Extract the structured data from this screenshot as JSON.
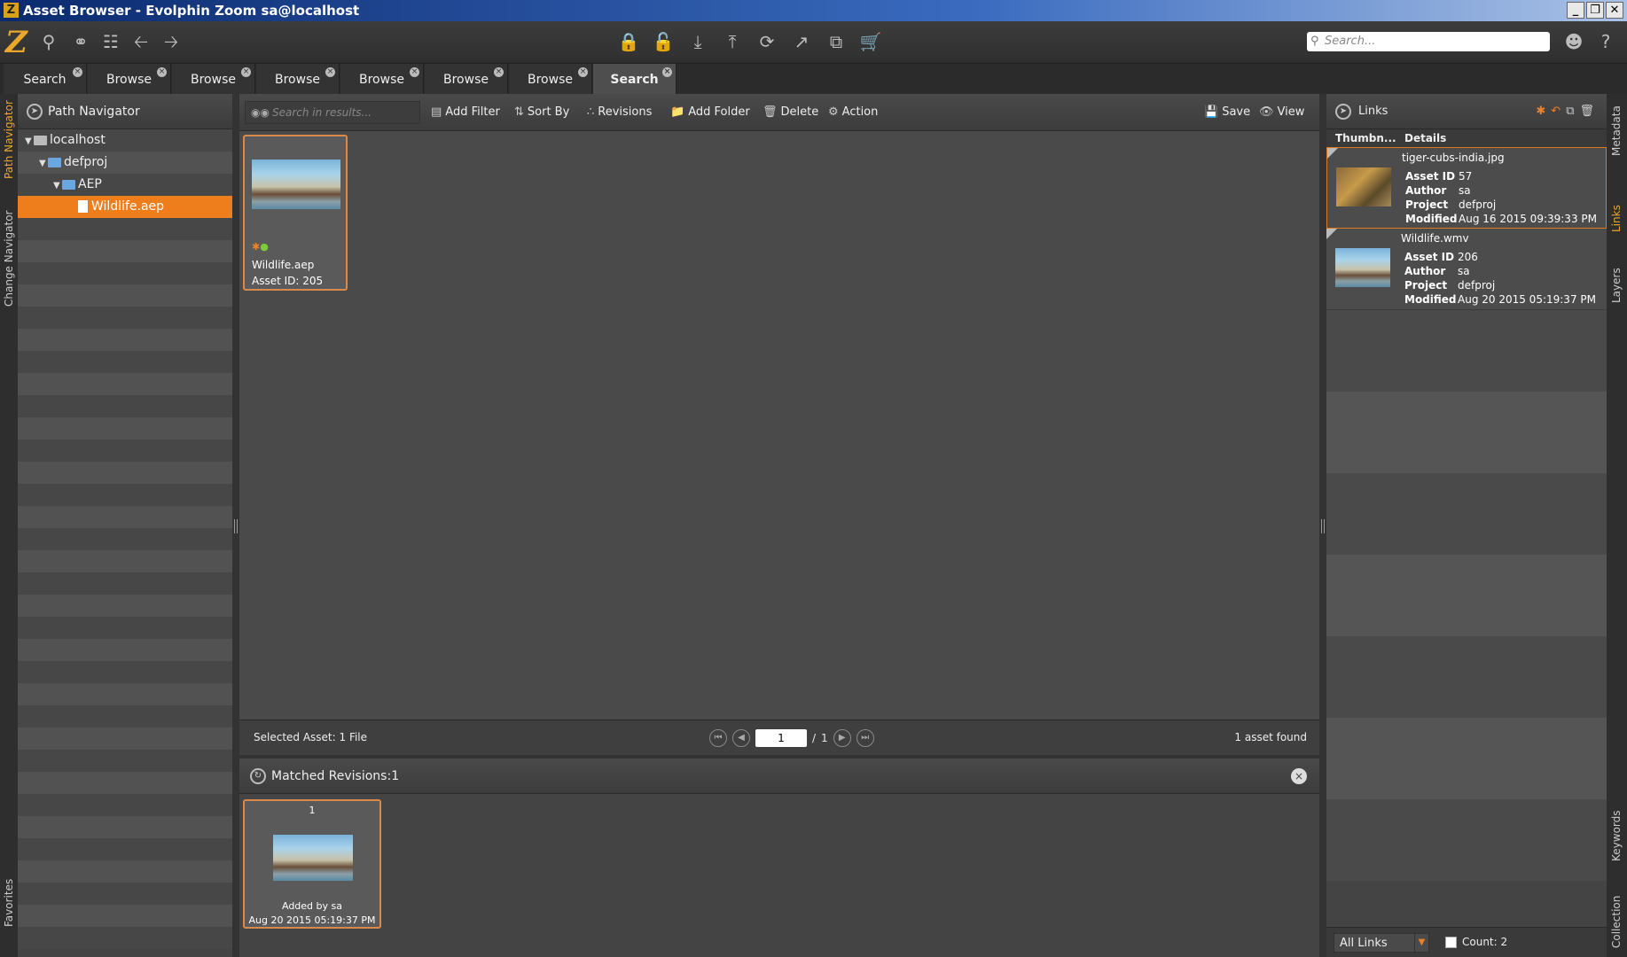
{
  "window": {
    "title": "Asset Browser - Evolphin Zoom sa@localhost",
    "logo_letter": "Z",
    "controls": [
      "_",
      "❐",
      "✕"
    ]
  },
  "toolbar": {
    "logo": "Z",
    "search_placeholder": "Search..."
  },
  "tabs": [
    {
      "label": "Search",
      "active": false
    },
    {
      "label": "Browse",
      "active": false
    },
    {
      "label": "Browse",
      "active": false
    },
    {
      "label": "Browse",
      "active": false
    },
    {
      "label": "Browse",
      "active": false
    },
    {
      "label": "Browse",
      "active": false
    },
    {
      "label": "Browse",
      "active": false
    },
    {
      "label": "Search",
      "active": true
    }
  ],
  "left_strip": {
    "path_navigator": "Path Navigator",
    "change_navigator": "Change Navigator",
    "favorites": "Favorites"
  },
  "path_navigator": {
    "title": "Path Navigator",
    "tree": [
      {
        "label": "localhost",
        "level": 0,
        "type": "server"
      },
      {
        "label": "defproj",
        "level": 1,
        "type": "folder"
      },
      {
        "label": "AEP",
        "level": 2,
        "type": "folder"
      },
      {
        "label": "Wildlife.aep",
        "level": 3,
        "type": "file",
        "selected": true
      }
    ]
  },
  "center_toolbar": {
    "search_placeholder": "Search in results...",
    "add_filter": "Add Filter",
    "sort_by": "Sort By",
    "revisions": "Revisions",
    "add_folder": "Add Folder",
    "delete": "Delete",
    "action": "Action",
    "save": "Save",
    "view": "View"
  },
  "assets": [
    {
      "name": "Wildlife.aep",
      "asset_id": "Asset ID: 205"
    }
  ],
  "status": {
    "selected": "Selected Asset: 1 File",
    "page": "1",
    "total_pages": "1",
    "found": "1 asset found"
  },
  "matched": {
    "title": "Matched Revisions:1",
    "revisions": [
      {
        "number": "1",
        "added_by": "Added by sa",
        "date": "Aug 20 2015 05:19:37 PM"
      }
    ]
  },
  "links": {
    "title": "Links",
    "col_thumb": "Thumbn...",
    "col_details": "Details",
    "key_asset_id": "Asset ID",
    "key_author": "Author",
    "key_project": "Project",
    "key_modified": "Modified",
    "items": [
      {
        "name": "tiger-cubs-india.jpg",
        "asset_id": "57",
        "author": "sa",
        "project": "defproj",
        "modified": "Aug 16 2015 09:39:33 PM"
      },
      {
        "name": "Wildlife.wmv",
        "asset_id": "206",
        "author": "sa",
        "project": "defproj",
        "modified": "Aug 20 2015 05:19:37 PM"
      }
    ],
    "filter": "All Links",
    "count": "Count: 2"
  },
  "right_strip": {
    "metadata": "Metadata",
    "links": "Links",
    "layers": "Layers",
    "keywords": "Keywords",
    "collection": "Collection"
  }
}
